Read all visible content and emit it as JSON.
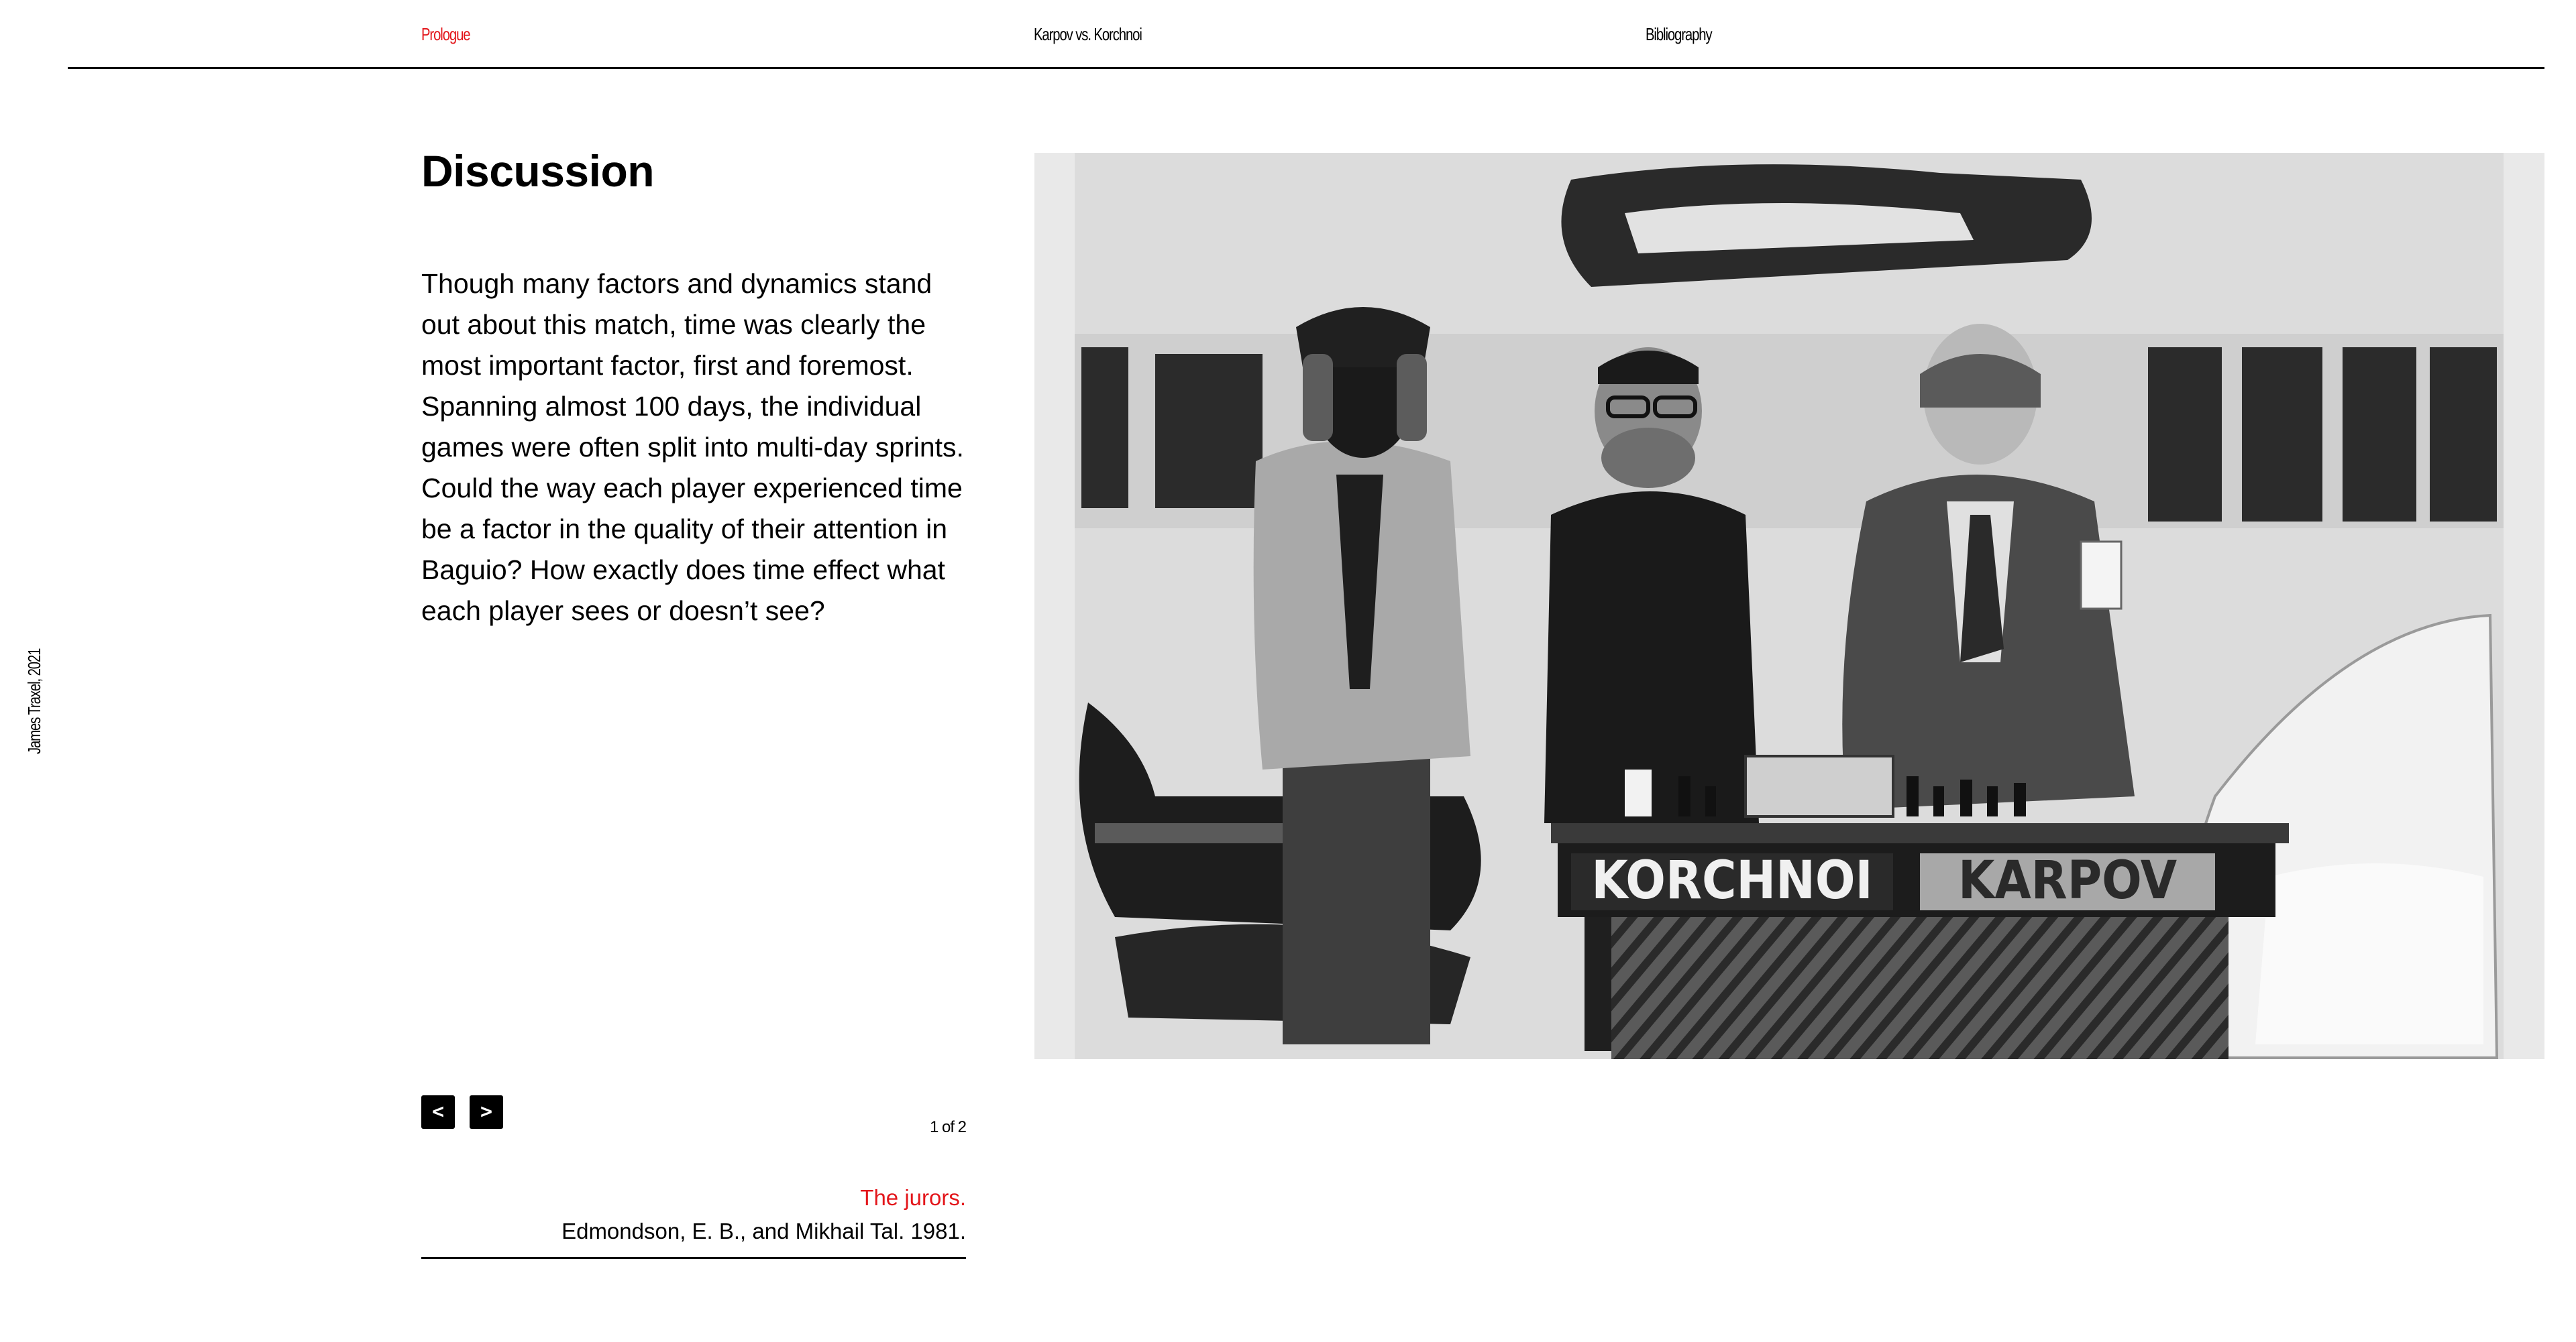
{
  "nav": {
    "items": [
      {
        "label": "Prologue",
        "active": true
      },
      {
        "label": "Karpov vs. Korchnoi",
        "active": false
      },
      {
        "label": "Bibliography",
        "active": false
      }
    ]
  },
  "credit": "James Traxel, 2021",
  "main": {
    "heading": "Discussion",
    "body": "Though many factors and dynamics stand out about this match, time was clearly the most important factor, first and foremost. Spanning almost 100 days, the individual games were often split into multi-day sprints. Could the way each player experienced time be a factor in the quality of their attention in Baguio? How exactly does time effect what each player sees or doesn’t see?"
  },
  "carousel": {
    "prev_label": "<",
    "next_label": ">",
    "counter": "1 of 2"
  },
  "caption": {
    "title": "The jurors.",
    "source": "Edmondson, E. B., and Mikhail Tal. 1981."
  },
  "photo": {
    "nameplate_left": "KORCHNOI",
    "nameplate_right": "KARPOV"
  },
  "colors": {
    "accent": "#e3161b",
    "text": "#000000",
    "background": "#ffffff"
  }
}
